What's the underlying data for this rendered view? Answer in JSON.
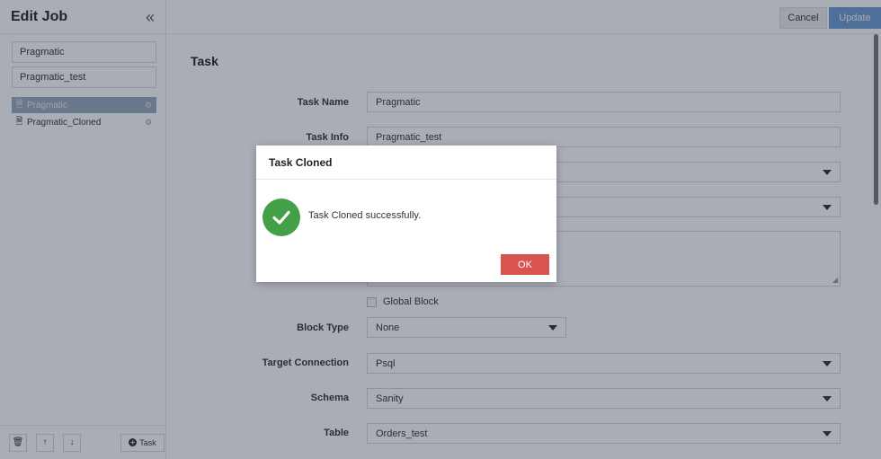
{
  "sidebar": {
    "title": "Edit Job",
    "fields": {
      "name": "Pragmatic",
      "info": "Pragmatic_test"
    },
    "tasks": [
      {
        "label": "Pragmatic",
        "active": true
      },
      {
        "label": "Pragmatic_Cloned",
        "active": false
      }
    ],
    "footer": {
      "add_task_label": "Task"
    }
  },
  "toolbar": {
    "cancel_label": "Cancel",
    "update_label": "Update"
  },
  "main": {
    "section_title": "Task",
    "form": {
      "task_name": {
        "label": "Task Name",
        "value": "Pragmatic"
      },
      "task_info": {
        "label": "Task Info",
        "value": "Pragmatic_test"
      },
      "global_block_label": "Global Block",
      "block_type": {
        "label": "Block Type",
        "value": "None"
      },
      "target_connection": {
        "label": "Target Connection",
        "value": "Psql"
      },
      "schema": {
        "label": "Schema",
        "value": "Sanity"
      },
      "table": {
        "label": "Table",
        "value": "Orders_test"
      }
    }
  },
  "modal": {
    "title": "Task Cloned",
    "message": "Task Cloned successfully.",
    "ok_label": "OK"
  },
  "colors": {
    "primary": "#6b9bd3",
    "danger": "#d9534f",
    "success": "#43a047",
    "active_item": "#9aaabf"
  }
}
